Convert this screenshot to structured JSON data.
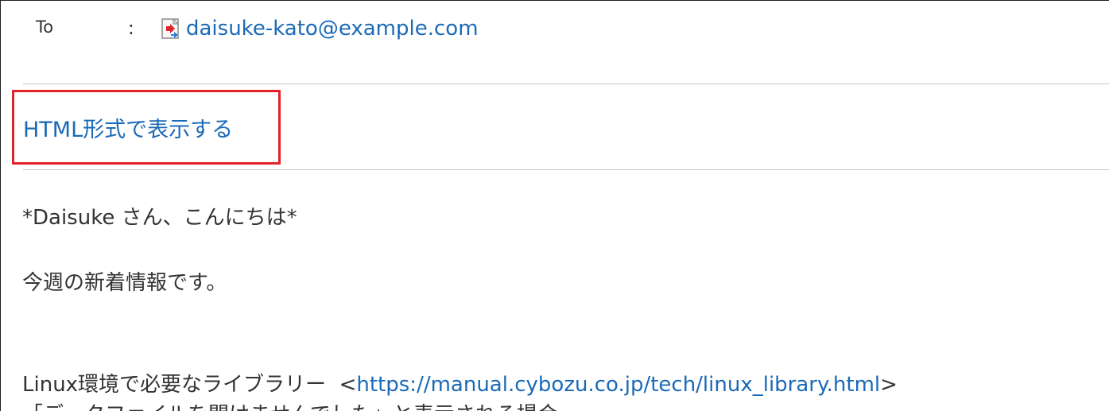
{
  "header": {
    "to_label": "To",
    "colon": ":",
    "to_address": "daisuke-kato@example.com"
  },
  "html_view": {
    "label": "HTML形式で表示する"
  },
  "message": {
    "greeting": "*Daisuke さん、こんにちは*",
    "intro": "今週の新着情報です。",
    "item_prefix": "Linux環境で必要なライブラリー",
    "item_bracket_open": "<",
    "item_url": "https://manual.cybozu.co.jp/tech/linux_library.html",
    "item_bracket_close": ">",
    "partial_next_line": "「データファイルを開けませんでした」と表示される場合"
  },
  "colors": {
    "link": "#1a6ab8",
    "text": "#333333",
    "highlight_border": "#e1232a",
    "divider": "#c4c4c4"
  }
}
